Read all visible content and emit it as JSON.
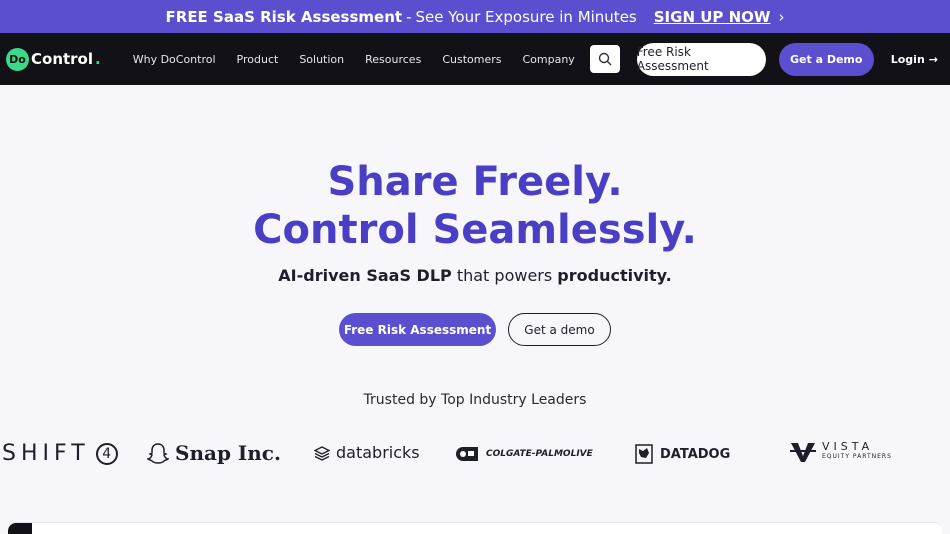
{
  "banner": {
    "bold": "FREE SaaS Risk Assessment",
    "sep": "-",
    "text": "See Your Exposure in Minutes",
    "cta": "SIGN UP NOW",
    "cta_icon": "chevron-right-icon"
  },
  "nav": {
    "logo_badge": "Do",
    "logo_text": "Control",
    "logo_dot": ".",
    "items": [
      "Why DoControl",
      "Product",
      "Solution",
      "Resources",
      "Customers",
      "Company"
    ],
    "search_icon": "search-icon",
    "free_risk": "Free Risk Assessment",
    "demo": "Get a Demo",
    "login": "Login",
    "login_icon": "arrow-right-icon"
  },
  "hero": {
    "line1": "Share Freely.",
    "line2": "Control Seamlessly.",
    "sub_bold1": "AI-driven SaaS DLP",
    "sub_mid": " that powers ",
    "sub_bold2": "productivity.",
    "btn_primary": "Free Risk Assessment",
    "btn_secondary": "Get a demo",
    "trusted": "Trusted by Top Industry Leaders"
  },
  "logos": {
    "shift": "SHIFT",
    "shift_num": "4",
    "snap": "Snap Inc.",
    "databricks": "databricks",
    "colgate": "COLGATE-PALMOLIVE",
    "datadog": "DATADOG",
    "vista": "VISTA",
    "vista_sub": "EQUITY PARTNERS"
  },
  "colors": {
    "brand_purple": "#5b4fd0",
    "headline_purple": "#4a3fc4",
    "nav_bg": "#111117",
    "logo_green": "#3bd98a"
  }
}
